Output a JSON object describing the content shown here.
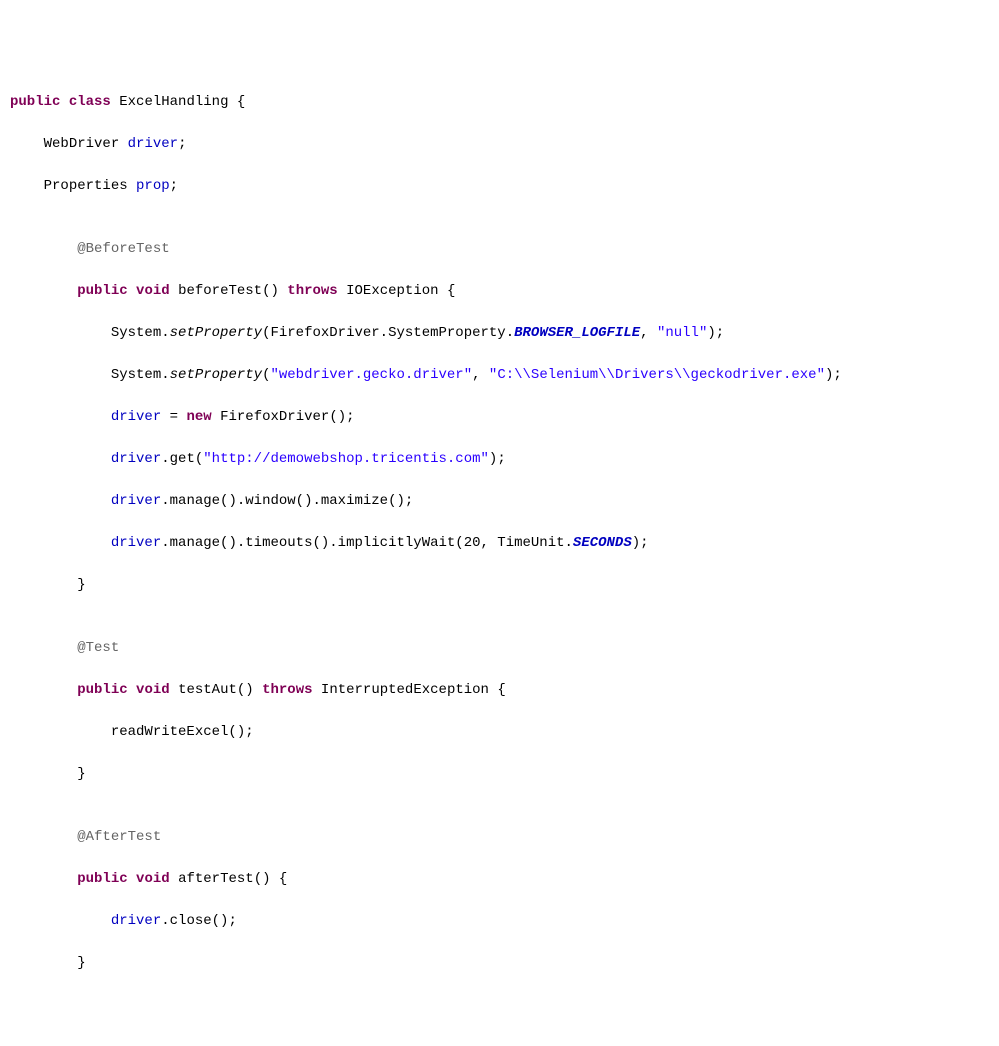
{
  "l1": {
    "t1": "public",
    "t2": " ",
    "t3": "class",
    "t4": " ",
    "t5": "ExcelHandling",
    "t6": " {"
  },
  "l2": {
    "t1": "    ",
    "t2": "WebDriver",
    "t3": " ",
    "t4": "driver",
    "t5": ";"
  },
  "l3": {
    "t1": "    ",
    "t2": "Properties",
    "t3": " ",
    "t4": "prop",
    "t5": ";"
  },
  "l4": {
    "t1": ""
  },
  "l5": {
    "t1": "        ",
    "t2": "@BeforeTest"
  },
  "l6": {
    "t1": "        ",
    "t2": "public",
    "t3": " ",
    "t4": "void",
    "t5": " ",
    "t6": "beforeTest",
    "t7": "() ",
    "t8": "throws",
    "t9": " ",
    "t10": "IOException",
    "t11": " {"
  },
  "l7": {
    "t1": "            ",
    "t2": "System.",
    "t3": "setProperty",
    "t4": "(",
    "t5": "FirefoxDriver.SystemProperty.",
    "t6": "BROWSER_LOGFILE",
    "t7": ", ",
    "t8": "\"null\"",
    "t9": ");"
  },
  "l8": {
    "t1": "            ",
    "t2": "System.",
    "t3": "setProperty",
    "t4": "(",
    "t5": "\"webdriver.gecko.driver\"",
    "t6": ", ",
    "t7": "\"C:\\\\Selenium\\\\Drivers\\\\geckodriver.exe\"",
    "t8": ");"
  },
  "l9": {
    "t1": "            ",
    "t2": "driver",
    "t3": " = ",
    "t4": "new",
    "t5": " ",
    "t6": "FirefoxDriver",
    "t7": "();"
  },
  "l10": {
    "t1": "            ",
    "t2": "driver",
    "t3": ".get(",
    "t4": "\"http://demowebshop.tricentis.com\"",
    "t5": ");"
  },
  "l11": {
    "t1": "            ",
    "t2": "driver",
    "t3": ".manage().window().maximize();"
  },
  "l12": {
    "t1": "            ",
    "t2": "driver",
    "t3": ".manage().timeouts().implicitlyWait(20, TimeUnit.",
    "t4": "SECONDS",
    "t5": ");"
  },
  "l13": {
    "t1": "        }"
  },
  "l14": {
    "t1": ""
  },
  "l15": {
    "t1": "        ",
    "t2": "@Test"
  },
  "l16": {
    "t1": "        ",
    "t2": "public",
    "t3": " ",
    "t4": "void",
    "t5": " ",
    "t6": "testAut",
    "t7": "() ",
    "t8": "throws",
    "t9": " ",
    "t10": "InterruptedException",
    "t11": " {"
  },
  "l17": {
    "t1": "            readWriteExcel();"
  },
  "l18": {
    "t1": "        }"
  },
  "l19": {
    "t1": ""
  },
  "l20": {
    "t1": "        ",
    "t2": "@AfterTest"
  },
  "l21": {
    "t1": "        ",
    "t2": "public",
    "t3": " ",
    "t4": "void",
    "t5": " ",
    "t6": "afterTest",
    "t7": "() {"
  },
  "l22": {
    "t1": "            ",
    "t2": "driver",
    "t3": ".close();"
  },
  "l23": {
    "t1": "        }"
  }
}
